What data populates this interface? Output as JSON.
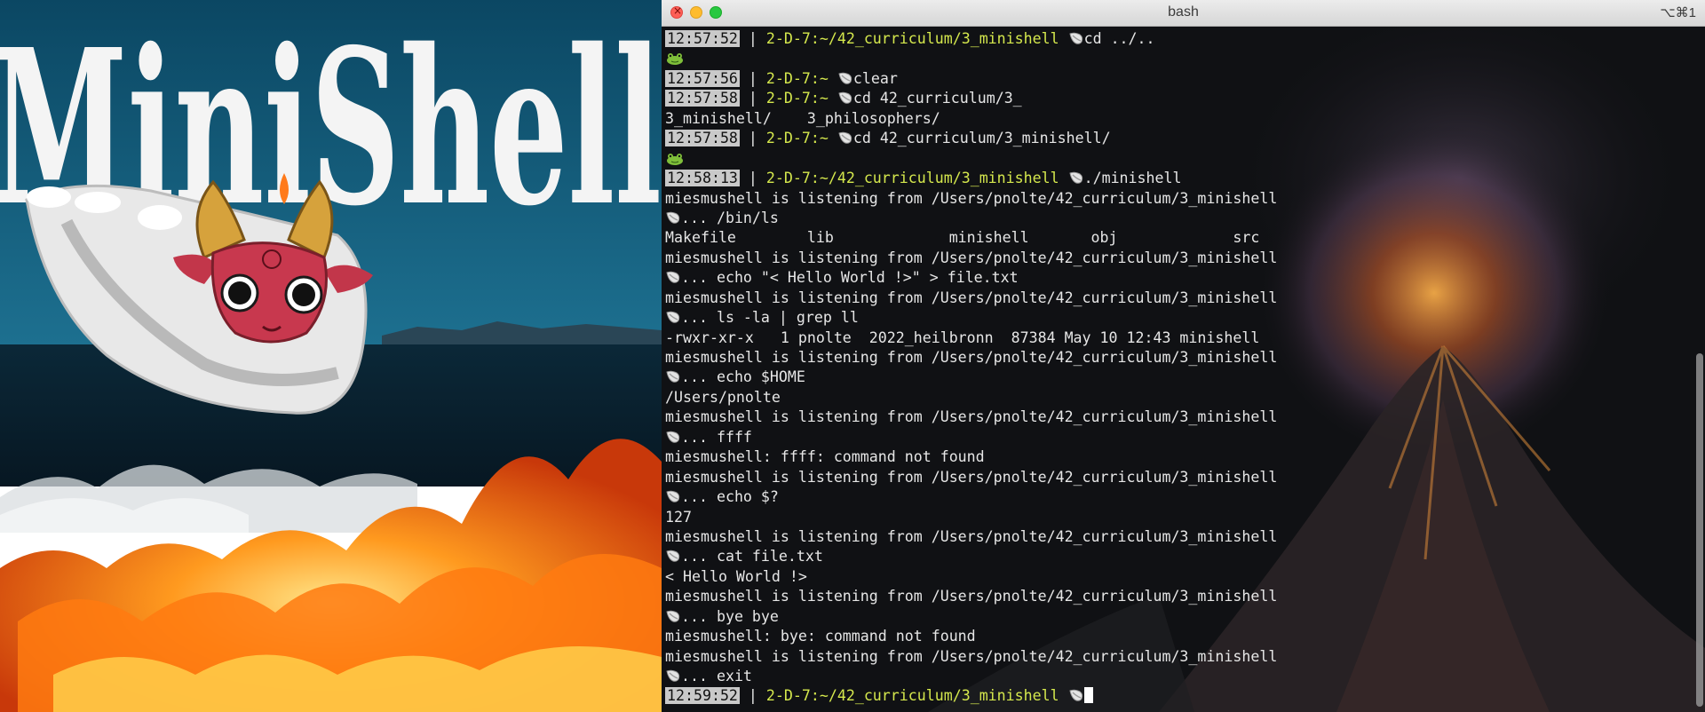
{
  "art": {
    "title": "MiniShell",
    "palette": {
      "text": "#f4f4f4",
      "sky": "#0e4f6b",
      "sea": "#0a2333",
      "fire": "#ff6a13"
    }
  },
  "window": {
    "title": "bash",
    "shortcut": "⌥⌘1",
    "colors": {
      "background": "#101114",
      "prompt": "#d5e84d",
      "timestamp_bg": "#c9c9c9",
      "text": "#e6e6e6"
    }
  },
  "terminal": {
    "lines": [
      {
        "kind": "prompt",
        "time": "12:57:52",
        "sep": " | ",
        "host": "2-D-7:~/42_curriculum/3_minishell ",
        "cmd": "cd ../.."
      },
      {
        "kind": "frog"
      },
      {
        "kind": "prompt",
        "time": "12:57:56",
        "sep": " | ",
        "host": "2-D-7:~ ",
        "cmd": "clear"
      },
      {
        "kind": "prompt",
        "time": "12:57:58",
        "sep": " | ",
        "host": "2-D-7:~ ",
        "cmd": "cd 42_curriculum/3_"
      },
      {
        "kind": "text",
        "text": "3_minishell/    3_philosophers/"
      },
      {
        "kind": "prompt",
        "time": "12:57:58",
        "sep": " | ",
        "host": "2-D-7:~ ",
        "cmd": "cd 42_curriculum/3_minishell/"
      },
      {
        "kind": "frog"
      },
      {
        "kind": "prompt",
        "time": "12:58:13",
        "sep": " | ",
        "host": "2-D-7:~/42_curriculum/3_minishell ",
        "cmd": "./minishell"
      },
      {
        "kind": "text",
        "text": "miesmushell is listening from /Users/pnolte/42_curriculum/3_minishell"
      },
      {
        "kind": "shell",
        "cmd": "... /bin/ls"
      },
      {
        "kind": "text",
        "text": "Makefile        lib             minishell       obj             src"
      },
      {
        "kind": "text",
        "text": "miesmushell is listening from /Users/pnolte/42_curriculum/3_minishell"
      },
      {
        "kind": "shell",
        "cmd": "... echo \"< Hello World !>\" > file.txt"
      },
      {
        "kind": "text",
        "text": "miesmushell is listening from /Users/pnolte/42_curriculum/3_minishell"
      },
      {
        "kind": "shell",
        "cmd": "... ls -la | grep ll"
      },
      {
        "kind": "text",
        "text": "-rwxr-xr-x   1 pnolte  2022_heilbronn  87384 May 10 12:43 minishell"
      },
      {
        "kind": "text",
        "text": "miesmushell is listening from /Users/pnolte/42_curriculum/3_minishell"
      },
      {
        "kind": "shell",
        "cmd": "... echo $HOME"
      },
      {
        "kind": "text",
        "text": "/Users/pnolte"
      },
      {
        "kind": "text",
        "text": "miesmushell is listening from /Users/pnolte/42_curriculum/3_minishell"
      },
      {
        "kind": "shell",
        "cmd": "... ffff"
      },
      {
        "kind": "text",
        "text": "miesmushell: ffff: command not found"
      },
      {
        "kind": "text",
        "text": "miesmushell is listening from /Users/pnolte/42_curriculum/3_minishell"
      },
      {
        "kind": "shell",
        "cmd": "... echo $?"
      },
      {
        "kind": "text",
        "text": "127"
      },
      {
        "kind": "text",
        "text": "miesmushell is listening from /Users/pnolte/42_curriculum/3_minishell"
      },
      {
        "kind": "shell",
        "cmd": "... cat file.txt"
      },
      {
        "kind": "text",
        "text": "< Hello World !>"
      },
      {
        "kind": "text",
        "text": "miesmushell is listening from /Users/pnolte/42_curriculum/3_minishell"
      },
      {
        "kind": "shell",
        "cmd": "... bye bye"
      },
      {
        "kind": "text",
        "text": "miesmushell: bye: command not found"
      },
      {
        "kind": "text",
        "text": "miesmushell is listening from /Users/pnolte/42_curriculum/3_minishell"
      },
      {
        "kind": "shell",
        "cmd": "... exit"
      },
      {
        "kind": "prompt",
        "time": "12:59:52",
        "sep": " | ",
        "host": "2-D-7:~/42_curriculum/3_minishell ",
        "cmd": "",
        "cursor": true
      }
    ]
  }
}
